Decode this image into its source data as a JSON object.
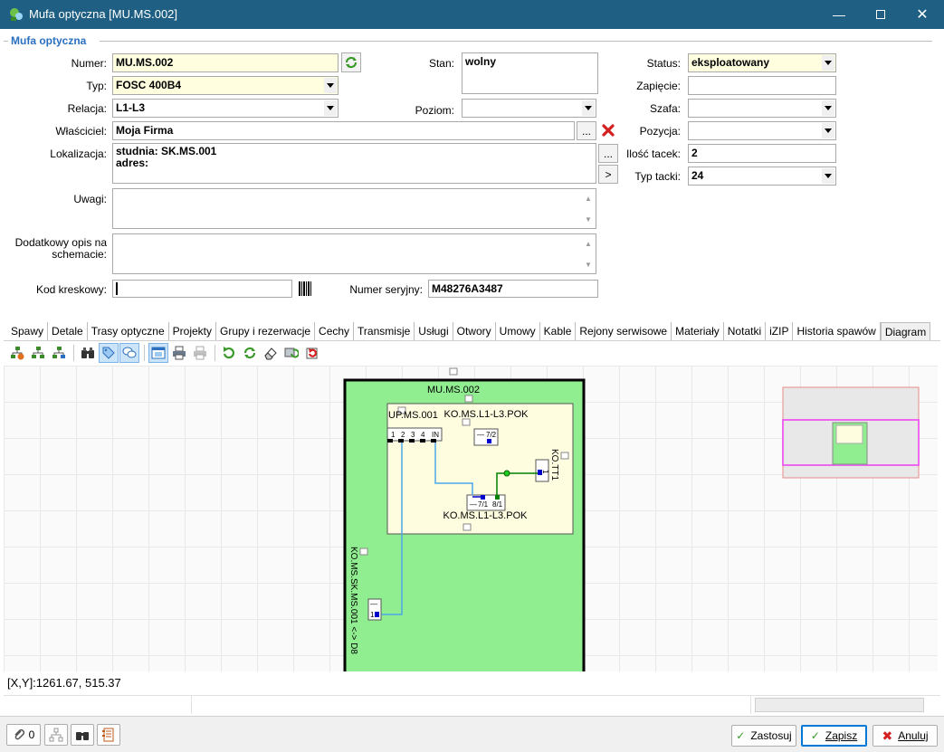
{
  "window": {
    "title": "Mufa optyczna [MU.MS.002]"
  },
  "group": {
    "label": "Mufa optyczna"
  },
  "form": {
    "numer": {
      "label": "Numer:",
      "value": "MU.MS.002"
    },
    "typ": {
      "label": "Typ:",
      "value": "FOSC 400B4"
    },
    "relacja": {
      "label": "Relacja:",
      "value": "L1-L3"
    },
    "wlasciciel": {
      "label": "Właściciel:",
      "value": "Moja Firma"
    },
    "lokalizacja": {
      "label": "Lokalizacja:",
      "line1": "studnia: SK.MS.001",
      "line2": "adres:"
    },
    "uwagi": {
      "label": "Uwagi:",
      "value": ""
    },
    "opis": {
      "label1": "Dodatkowy opis na",
      "label2": "schemacie:",
      "value": ""
    },
    "kod": {
      "label": "Kod kreskowy:",
      "value": ""
    },
    "stan": {
      "label": "Stan:",
      "value": "wolny"
    },
    "poziom": {
      "label": "Poziom:",
      "value": ""
    },
    "numer_seryjny": {
      "label": "Numer seryjny:",
      "value": "M48276A3487"
    },
    "status": {
      "label": "Status:",
      "value": "eksploatowany"
    },
    "zapiecie": {
      "label": "Zapięcie:",
      "value": ""
    },
    "szafa": {
      "label": "Szafa:",
      "value": ""
    },
    "pozycja": {
      "label": "Pozycja:",
      "value": ""
    },
    "ilosc_tacek": {
      "label": "Ilość tacek:",
      "value": "2"
    },
    "typ_tacki": {
      "label": "Typ tacki:",
      "value": "24"
    },
    "ellipsis": "...",
    "arrow": ">"
  },
  "tabs": [
    "Spawy",
    "Detale",
    "Trasy optyczne",
    "Projekty",
    "Grupy i rezerwacje",
    "Cechy",
    "Transmisje",
    "Usługi",
    "Otwory",
    "Umowy",
    "Kable",
    "Rejony serwisowe",
    "Materiały",
    "Notatki",
    "iZIP",
    "Historia spawów",
    "Diagram"
  ],
  "active_tab": "Diagram",
  "diagram": {
    "mufa_title": "MU.MS.002",
    "panel_left": "UP.MS.001",
    "panel_top": "KO.MS.L1-L3.POK",
    "panel_bottom": "KO.MS.L1-L3.POK",
    "port_labels": [
      "1",
      "2",
      "3",
      "4",
      "IN"
    ],
    "box_72": "7/2",
    "box_71": "7/1",
    "box_81": "8/1",
    "tt1_label": "KO.TT1",
    "tt1_port": "1",
    "left_cable_label": "KO.MS.SK.MS.001 <-> D8",
    "left_port": "1",
    "minus": "—",
    "colors": {
      "mufa_bg": "#90ee90",
      "panel_bg": "#fffde0",
      "blue_line": "#4da6e8",
      "dark_blue": "#0000cc",
      "green_line": "#008000"
    }
  },
  "coords": "[X,Y]:1261.67, 515.37",
  "bottom": {
    "attach_count": "0",
    "apply": "Zastosuj",
    "save": "Zapisz",
    "cancel": "Anuluj"
  }
}
